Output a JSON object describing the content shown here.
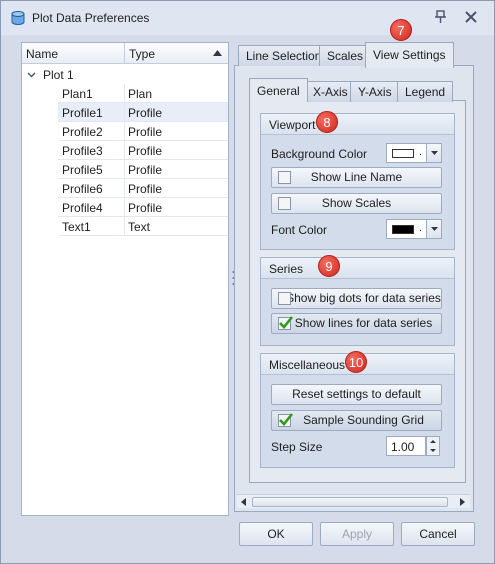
{
  "window": {
    "title": "Plot Data Preferences"
  },
  "tree": {
    "columns": {
      "name": "Name",
      "type": "Type"
    },
    "root": "Plot 1",
    "rows": [
      {
        "name": "Plan1",
        "type": "Plan"
      },
      {
        "name": "Profile1",
        "type": "Profile"
      },
      {
        "name": "Profile2",
        "type": "Profile"
      },
      {
        "name": "Profile3",
        "type": "Profile"
      },
      {
        "name": "Profile5",
        "type": "Profile"
      },
      {
        "name": "Profile6",
        "type": "Profile"
      },
      {
        "name": "Profile4",
        "type": "Profile"
      },
      {
        "name": "Text1",
        "type": "Text"
      }
    ],
    "selected_row": "Profile1"
  },
  "tabs": {
    "top": [
      "Line Selection",
      "Scales",
      "View Settings"
    ],
    "top_active": "View Settings",
    "inner": [
      "General",
      "X-Axis",
      "Y-Axis",
      "Legend"
    ],
    "inner_active": "General"
  },
  "viewport": {
    "title": "Viewport",
    "background_color_label": "Background Color",
    "background_color_value": "#ffffff",
    "show_line_name": "Show Line Name",
    "show_line_name_checked": false,
    "show_scales": "Show Scales",
    "show_scales_checked": false,
    "font_color_label": "Font Color",
    "font_color_value": "#000000"
  },
  "series": {
    "title": "Series",
    "show_big_dots": "Show big dots for data series",
    "show_big_dots_checked": false,
    "show_lines": "Show lines for data series",
    "show_lines_checked": true
  },
  "misc": {
    "title": "Miscellaneous",
    "reset": "Reset settings to default",
    "sample_grid": "Sample Sounding Grid",
    "sample_grid_checked": true,
    "step_size_label": "Step Size",
    "step_size_value": "1.00"
  },
  "badges": {
    "top_tab": "7",
    "viewport": "8",
    "series": "9",
    "misc": "10"
  },
  "footer": {
    "ok": "OK",
    "apply": "Apply",
    "cancel": "Cancel"
  },
  "colors": {
    "accent": "#d2261c",
    "check": "#2f9a1e",
    "chrome": "#d6dbe9"
  }
}
